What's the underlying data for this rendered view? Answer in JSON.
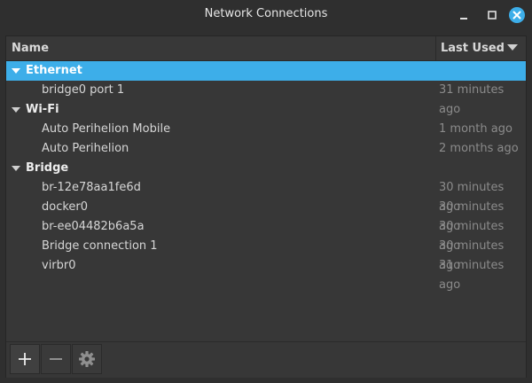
{
  "window": {
    "title": "Network Connections"
  },
  "header": {
    "name": "Name",
    "last_used": "Last Used"
  },
  "groups": [
    {
      "label": "Ethernet",
      "selected": true,
      "items": [
        {
          "name": "bridge0 port 1",
          "last_used": "31 minutes ago"
        }
      ]
    },
    {
      "label": "Wi-Fi",
      "selected": false,
      "items": [
        {
          "name": "Auto Perihelion Mobile",
          "last_used": "1 month ago"
        },
        {
          "name": "Auto Perihelion",
          "last_used": "2 months ago"
        }
      ]
    },
    {
      "label": "Bridge",
      "selected": false,
      "items": [
        {
          "name": "br-12e78aa1fe6d",
          "last_used": "30 minutes ago"
        },
        {
          "name": "docker0",
          "last_used": "30 minutes ago"
        },
        {
          "name": "br-ee04482b6a5a",
          "last_used": "30 minutes ago"
        },
        {
          "name": "Bridge connection 1",
          "last_used": "30 minutes ago"
        },
        {
          "name": "virbr0",
          "last_used": "31 minutes ago"
        }
      ]
    }
  ],
  "colors": {
    "accent": "#3daee9",
    "close": "#3daee9"
  },
  "icons": [
    "minimize-icon",
    "maximize-icon",
    "close-icon",
    "sort-down-icon",
    "expand-triangle-icon",
    "add-icon",
    "remove-icon",
    "gear-icon"
  ]
}
